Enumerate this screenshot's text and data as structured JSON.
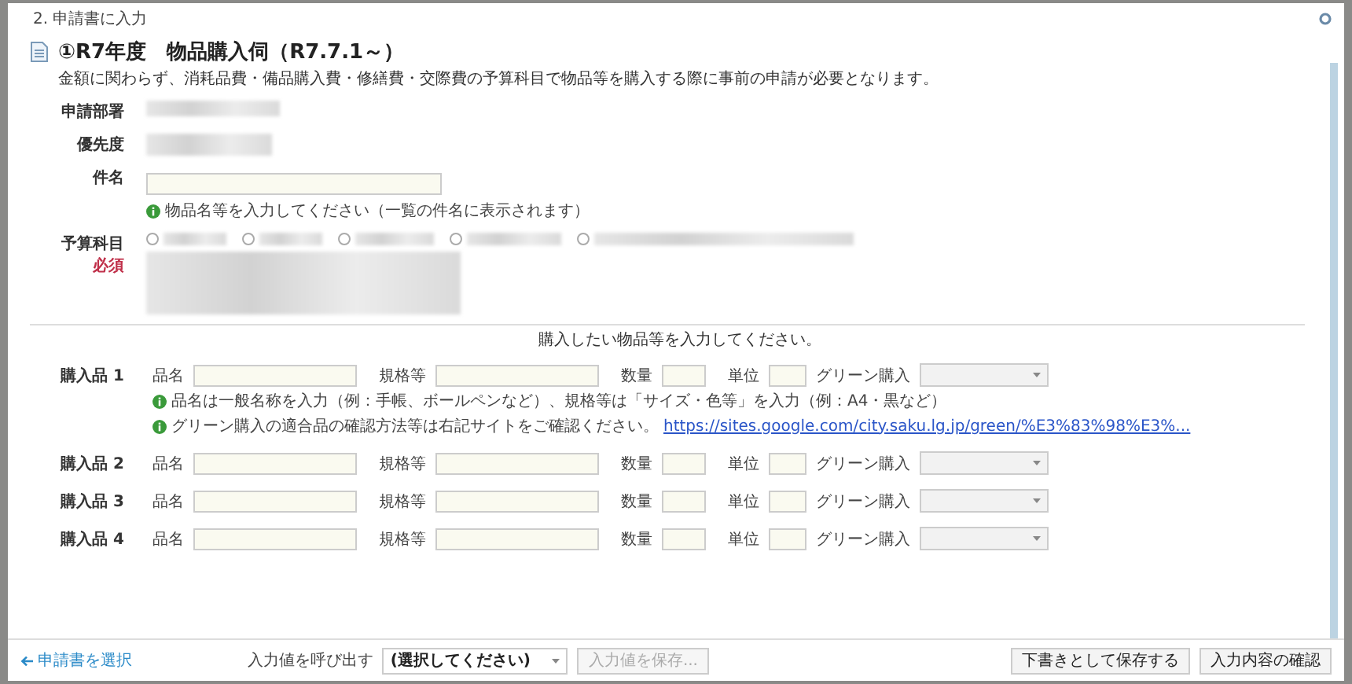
{
  "dialog": {
    "step_title": "2. 申請書に入力"
  },
  "form": {
    "title": "①R7年度　物品購入伺（R7.7.1～）",
    "description": "金額に関わらず、消耗品費・備品購入費・修繕費・交際費の予算科目で物品等を購入する際に事前の申請が必要となります。",
    "fields": [
      {
        "kind": "blurred",
        "label": "申請部署"
      },
      {
        "kind": "blurred",
        "label": "優先度"
      },
      {
        "kind": "input",
        "label": "件名",
        "hint": "物品名等を入力してください（一覧の件名に表示されます）"
      },
      {
        "kind": "radio",
        "label": "予算科目",
        "required": "必須",
        "options": [
          {
            "selected": false
          },
          {
            "selected": false
          },
          {
            "selected": false
          },
          {
            "selected": false
          },
          {
            "selected": false
          }
        ]
      }
    ]
  },
  "items_prompt": "購入したい物品等を入力してください。",
  "items": [
    {
      "label": "購入品 1",
      "name_label": "品名",
      "spec_label": "規格等",
      "qty_label": "数量",
      "unit_label": "単位",
      "green_label": "グリーン購入",
      "hints": [
        {
          "text": "品名は一般名称を入力（例：手帳、ボールペンなど）、規格等は「サイズ・色等」を入力（例：A4・黒など）"
        },
        {
          "text": "グリーン購入の適合品の確認方法等は右記サイトをご確認ください。",
          "link": "https://sites.google.com/city.saku.lg.jp/green/%E3%83%98%E3%..."
        }
      ]
    },
    {
      "label": "購入品 2",
      "name_label": "品名",
      "spec_label": "規格等",
      "qty_label": "数量",
      "unit_label": "単位",
      "green_label": "グリーン購入"
    },
    {
      "label": "購入品 3",
      "name_label": "品名",
      "spec_label": "規格等",
      "qty_label": "数量",
      "unit_label": "単位",
      "green_label": "グリーン購入"
    },
    {
      "label": "購入品 4",
      "name_label": "品名",
      "spec_label": "規格等",
      "qty_label": "数量",
      "unit_label": "単位",
      "green_label": "グリーン購入"
    }
  ],
  "footer": {
    "back_link": "申請書を選択",
    "recall_label": "入力値を呼び出す",
    "recall_select": "(選択してください)",
    "save_values_button": {
      "label": "入力値を保存...",
      "disabled": true
    },
    "buttons": [
      "下書きとして保存する",
      "入力内容の確認"
    ]
  }
}
